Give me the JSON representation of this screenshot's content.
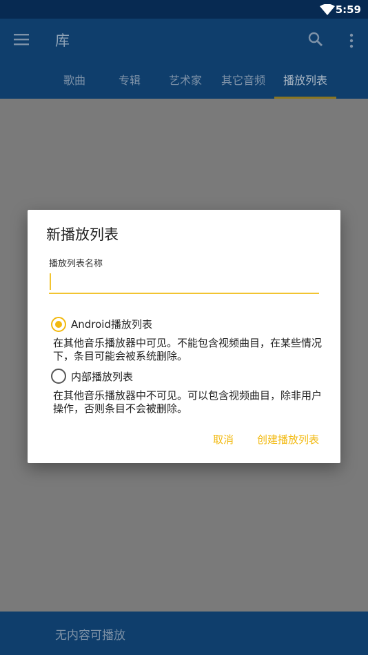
{
  "status_bar": {
    "time": "5:59",
    "wifi_icon": "wifi-icon"
  },
  "app_bar": {
    "title": "库",
    "menu_icon": "menu-icon",
    "search_icon": "search-icon",
    "more_icon": "more-vert-icon"
  },
  "tabs": [
    {
      "label": "歌曲",
      "active": false
    },
    {
      "label": "专辑",
      "active": false
    },
    {
      "label": "艺术家",
      "active": false
    },
    {
      "label": "其它音频",
      "active": false
    },
    {
      "label": "播放列表",
      "active": true
    }
  ],
  "dialog": {
    "title": "新播放列表",
    "field_label": "播放列表名称",
    "field_value": "",
    "options": [
      {
        "label": "Android播放列表",
        "description": "在其他音乐播放器中可见。不能包含视频曲目，在某些情况下，条目可能会被系统删除。",
        "checked": true
      },
      {
        "label": "内部播放列表",
        "description": "在其他音乐播放器中不可见。可以包含视频曲目，除非用户操作，否则条目不会被删除。",
        "checked": false
      }
    ],
    "cancel_label": "取消",
    "create_label": "创建播放列表"
  },
  "bottom_bar": {
    "now_playing": "无内容可播放"
  },
  "colors": {
    "primary": "#0f3e6c",
    "accent": "#f2b90f",
    "status_bar": "#072a52"
  }
}
